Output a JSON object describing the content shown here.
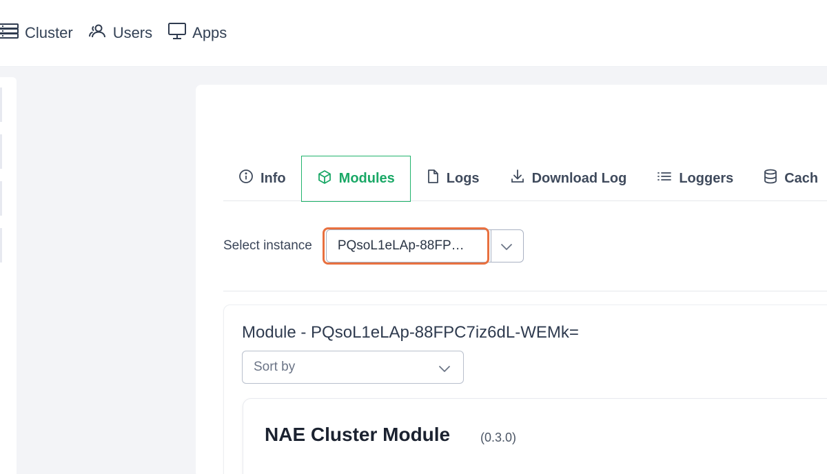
{
  "nav": {
    "items": [
      {
        "label": "Cluster",
        "icon": "server-icon"
      },
      {
        "label": "Users",
        "icon": "users-icon"
      },
      {
        "label": "Apps",
        "icon": "monitor-icon"
      }
    ]
  },
  "tabs": [
    {
      "label": "Info",
      "icon": "info-icon",
      "active": false
    },
    {
      "label": "Modules",
      "icon": "cube-icon",
      "active": true
    },
    {
      "label": "Logs",
      "icon": "file-icon",
      "active": false
    },
    {
      "label": "Download Log",
      "icon": "download-icon",
      "active": false
    },
    {
      "label": "Loggers",
      "icon": "list-icon",
      "active": false
    },
    {
      "label": "Cach",
      "icon": "database-icon",
      "active": false
    }
  ],
  "instance": {
    "label": "Select instance",
    "value": "PQsoL1eLAp-88FP…"
  },
  "module": {
    "title": "Module - PQsoL1eLAp-88FPC7iz6dL-WEMk=",
    "sort_placeholder": "Sort by",
    "cards": [
      {
        "name": "NAE Cluster Module",
        "version": "(0.3.0)"
      }
    ]
  },
  "colors": {
    "accent": "#1fb36b",
    "highlight": "#e8703f",
    "background": "#f3f4f7"
  }
}
